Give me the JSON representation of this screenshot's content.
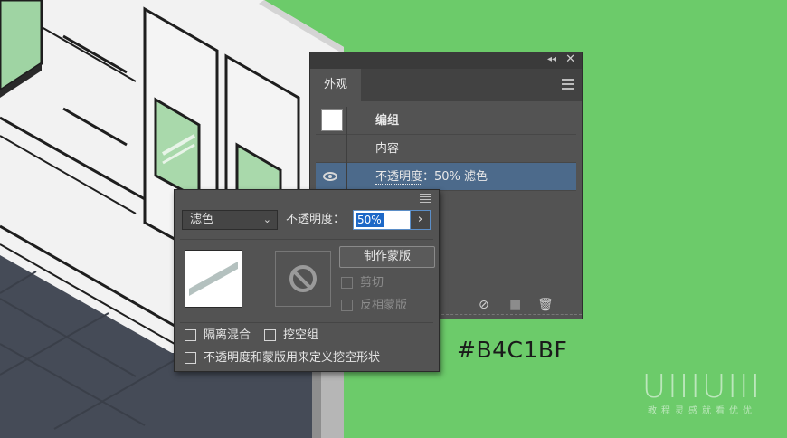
{
  "background": {
    "color": "#6ccb6a",
    "artwork": "pixel-art isometric train car illustration"
  },
  "color_label": "#B4C1BF",
  "watermark": {
    "logo": "UIIIUIII",
    "subtitle": "教程灵感就看优优"
  },
  "appearance_panel": {
    "collapse_icon": "double-chevron-left-icon",
    "close_icon": "close-icon",
    "tab": "外观",
    "menu_icon": "hamburger-menu-icon",
    "rows": [
      {
        "label": "编组",
        "bold": true,
        "thumbnail": true
      },
      {
        "label": "内容"
      },
      {
        "label_prefix": "不透明度",
        "label_suffix": "：50% 滤色",
        "selected": true,
        "visibility_icon": "eye-icon"
      }
    ],
    "bottom_icons": [
      "clear-appearance-icon",
      "duplicate-item-icon",
      "trash-icon"
    ]
  },
  "transparency_popup": {
    "menu_icon": "list-menu-icon",
    "blend_mode": "滤色",
    "opacity_label": "不透明度：",
    "opacity_value": "50%",
    "opacity_button": "›",
    "object_thumbnail": "artwork-thumbnail",
    "mask_thumbnail": "no-mask-icon",
    "make_mask_button": "制作蒙版",
    "clip_label": "剪切",
    "invert_mask_label": "反相蒙版",
    "isolate_blending_label": "隔离混合",
    "knockout_group_label": "挖空组",
    "opacity_mask_knockout_label": "不透明度和蒙版用来定义挖空形状",
    "accent_color": "#1d68c7"
  }
}
